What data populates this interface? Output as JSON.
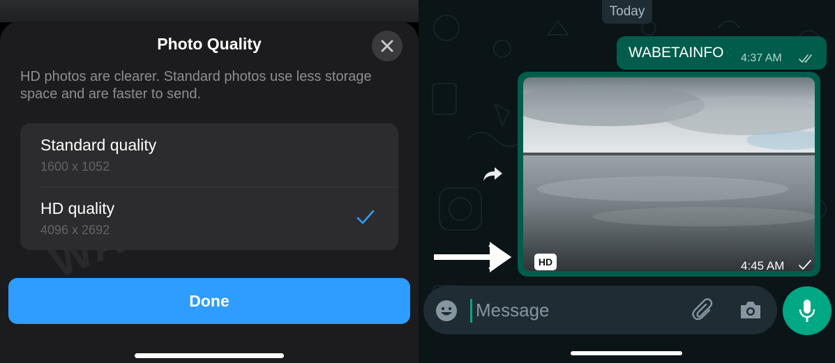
{
  "left_panel": {
    "sheet": {
      "title": "Photo Quality",
      "description": "HD photos are clearer. Standard photos use less storage space and are faster to send.",
      "options": [
        {
          "label": "Standard quality",
          "resolution": "1600 x 1052",
          "selected": false
        },
        {
          "label": "HD quality",
          "resolution": "4096 x 2692",
          "selected": true
        }
      ],
      "done_label": "Done"
    },
    "watermark_text": "WABETAINFO",
    "accent_color": "#2f9cff"
  },
  "right_panel": {
    "date_divider": "Today",
    "outgoing_message": {
      "text": "WABETAINFO",
      "time": "4:37 AM",
      "status_icon": "double-check-icon"
    },
    "media_message": {
      "badge": "HD",
      "time": "4:45 AM",
      "status_icon": "single-check-icon"
    },
    "composer": {
      "placeholder": "Message"
    },
    "icons": [
      "forward-icon",
      "arrow-right-icon",
      "emoji-icon",
      "attach-icon",
      "camera-icon",
      "mic-icon"
    ],
    "accent_color": "#00a884",
    "bubble_color": "#005c4b"
  }
}
